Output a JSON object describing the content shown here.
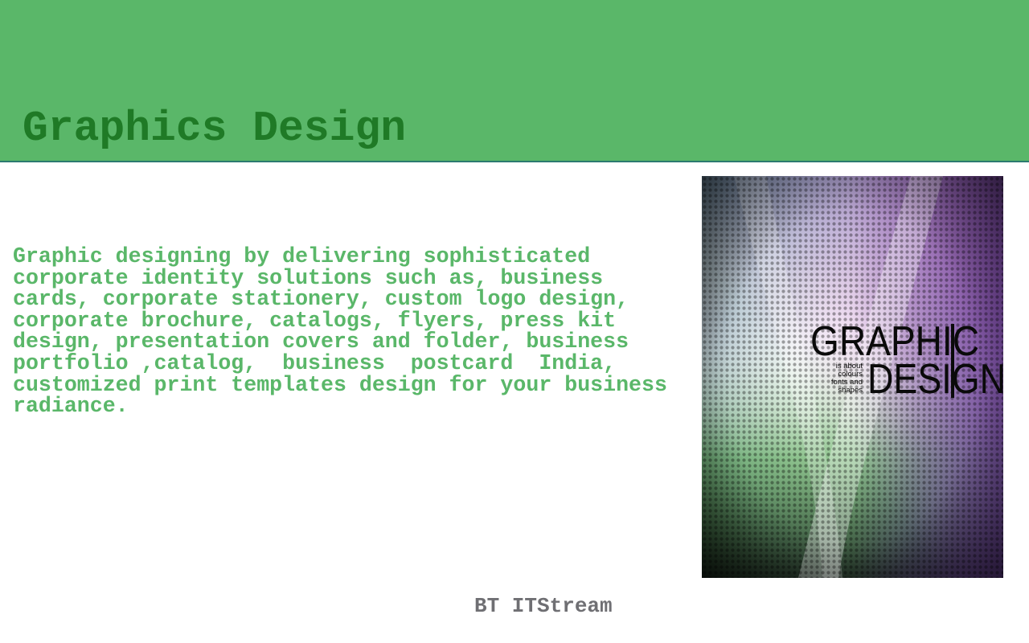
{
  "header": {
    "title": "Graphics Design",
    "background_color": "#5ab769",
    "title_color": "#1f7a26"
  },
  "main": {
    "description": "Graphic designing by delivering sophisticated\ncorporate identity solutions such as, business\ncards, corporate stationery, custom logo design,\ncorporate brochure, catalogs, flyers, press kit\ndesign, presentation covers and folder, business\nportfolio ,catalog,  business  postcard  India,\ncustomized print templates design for your business\nradiance.",
    "text_color": "#5ab769"
  },
  "poster": {
    "line1": "GRAPHIC",
    "line2": "DESIGN",
    "tagline": [
      "is about",
      "colours",
      "fonts and",
      "shapes"
    ]
  },
  "footer": {
    "text": "BT ITStream",
    "color": "#6f6f73"
  }
}
